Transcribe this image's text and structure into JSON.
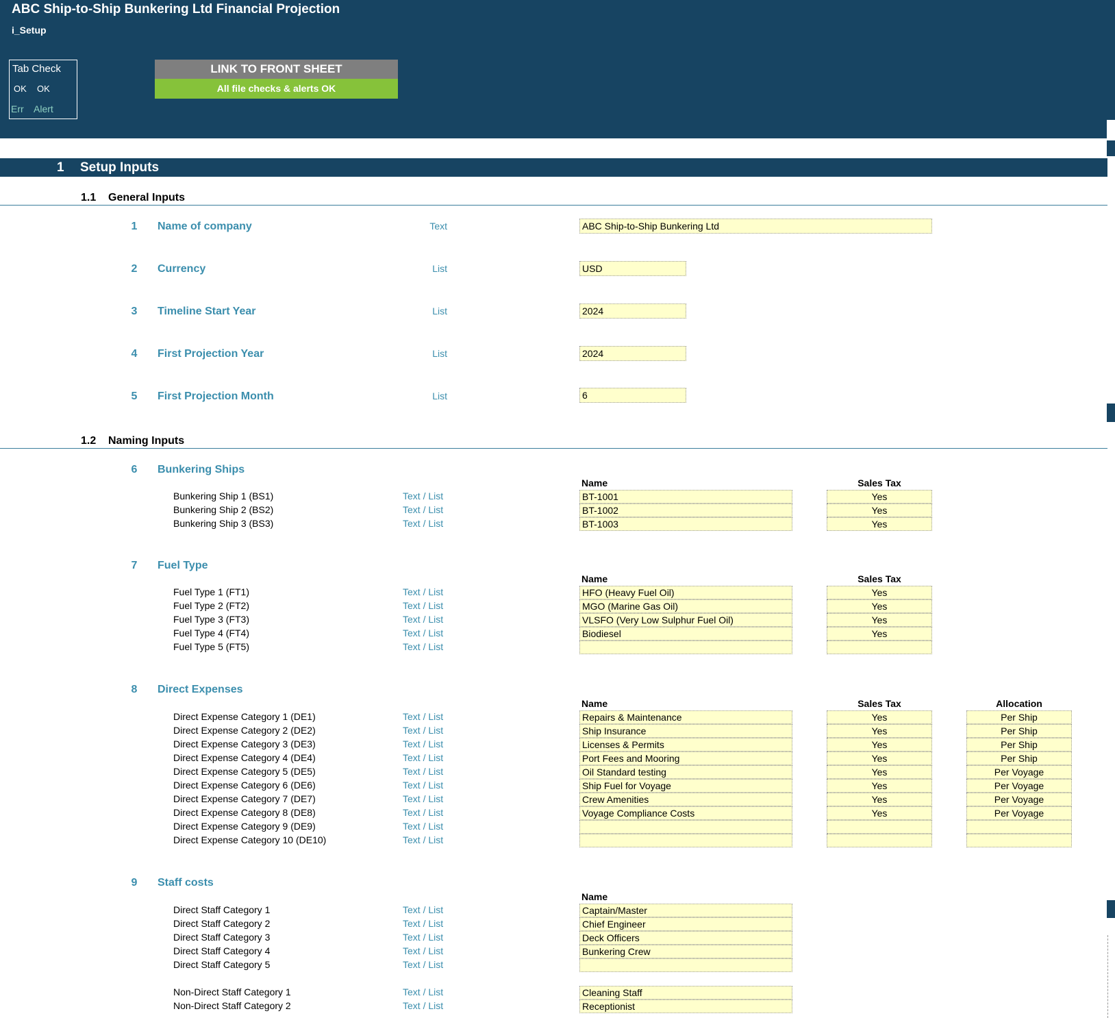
{
  "header": {
    "title": "ABC Ship-to-Ship Bunkering Ltd Financial Projection",
    "sheet": "i_Setup",
    "tab_check": {
      "title": "Tab Check",
      "ok1": "OK",
      "ok2": "OK",
      "err": "Err",
      "alert": "Alert"
    },
    "link_button": "LINK TO FRONT SHEET",
    "check_status": "All file checks & alerts OK"
  },
  "section": {
    "number": "1",
    "title": "Setup Inputs"
  },
  "general": {
    "number": "1.1",
    "title": "General Inputs",
    "items": [
      {
        "num": "1",
        "label": "Name of company",
        "type": "Text",
        "value": "ABC Ship-to-Ship Bunkering Ltd"
      },
      {
        "num": "2",
        "label": "Currency",
        "type": "List",
        "value": "USD"
      },
      {
        "num": "3",
        "label": "Timeline Start Year",
        "type": "List",
        "value": "2024"
      },
      {
        "num": "4",
        "label": "First Projection Year",
        "type": "List",
        "value": "2024"
      },
      {
        "num": "5",
        "label": "First Projection Month",
        "type": "List",
        "value": "6"
      }
    ]
  },
  "naming": {
    "number": "1.2",
    "title": "Naming Inputs",
    "col_name": "Name",
    "col_sales_tax": "Sales Tax",
    "col_allocation": "Allocation",
    "ships": {
      "num": "6",
      "title": "Bunkering Ships",
      "rows": [
        {
          "label": "Bunkering Ship 1 (BS1)",
          "type": "Text / List",
          "name": "BT-1001",
          "tax": "Yes"
        },
        {
          "label": "Bunkering Ship 2 (BS2)",
          "type": "Text / List",
          "name": "BT-1002",
          "tax": "Yes"
        },
        {
          "label": "Bunkering Ship 3 (BS3)",
          "type": "Text / List",
          "name": "BT-1003",
          "tax": "Yes"
        }
      ]
    },
    "fuel": {
      "num": "7",
      "title": "Fuel Type",
      "rows": [
        {
          "label": "Fuel Type 1 (FT1)",
          "type": "Text / List",
          "name": "HFO (Heavy Fuel Oil)",
          "tax": "Yes"
        },
        {
          "label": "Fuel Type 2 (FT2)",
          "type": "Text / List",
          "name": "MGO (Marine Gas Oil)",
          "tax": "Yes"
        },
        {
          "label": "Fuel Type 3 (FT3)",
          "type": "Text / List",
          "name": "VLSFO (Very Low Sulphur Fuel Oil)",
          "tax": "Yes"
        },
        {
          "label": "Fuel Type 4 (FT4)",
          "type": "Text / List",
          "name": "Biodiesel",
          "tax": "Yes"
        },
        {
          "label": "Fuel Type 5 (FT5)",
          "type": "Text / List",
          "name": "",
          "tax": ""
        }
      ]
    },
    "direct": {
      "num": "8",
      "title": "Direct Expenses",
      "rows": [
        {
          "label": "Direct Expense Category 1 (DE1)",
          "type": "Text / List",
          "name": "Repairs & Maintenance",
          "tax": "Yes",
          "alloc": "Per Ship"
        },
        {
          "label": "Direct Expense Category 2 (DE2)",
          "type": "Text / List",
          "name": "Ship Insurance",
          "tax": "Yes",
          "alloc": "Per Ship"
        },
        {
          "label": "Direct Expense Category 3 (DE3)",
          "type": "Text / List",
          "name": "Licenses & Permits",
          "tax": "Yes",
          "alloc": "Per Ship"
        },
        {
          "label": "Direct Expense Category 4 (DE4)",
          "type": "Text / List",
          "name": "Port Fees and Mooring",
          "tax": "Yes",
          "alloc": "Per Ship"
        },
        {
          "label": "Direct Expense Category 5 (DE5)",
          "type": "Text / List",
          "name": "Oil Standard testing",
          "tax": "Yes",
          "alloc": "Per Voyage"
        },
        {
          "label": "Direct Expense Category 6 (DE6)",
          "type": "Text / List",
          "name": "Ship Fuel for Voyage",
          "tax": "Yes",
          "alloc": "Per Voyage"
        },
        {
          "label": "Direct Expense Category 7 (DE7)",
          "type": "Text / List",
          "name": "Crew Amenities",
          "tax": "Yes",
          "alloc": "Per Voyage"
        },
        {
          "label": "Direct Expense Category 8 (DE8)",
          "type": "Text / List",
          "name": "Voyage Compliance Costs",
          "tax": "Yes",
          "alloc": "Per Voyage"
        },
        {
          "label": "Direct Expense Category 9 (DE9)",
          "type": "Text / List",
          "name": "",
          "tax": "",
          "alloc": ""
        },
        {
          "label": "Direct Expense Category 10 (DE10)",
          "type": "Text / List",
          "name": "",
          "tax": "",
          "alloc": ""
        }
      ]
    },
    "staff": {
      "num": "9",
      "title": "Staff costs",
      "direct_rows": [
        {
          "label": "Direct Staff Category 1",
          "type": "Text / List",
          "name": "Captain/Master"
        },
        {
          "label": "Direct Staff Category 2",
          "type": "Text / List",
          "name": "Chief Engineer"
        },
        {
          "label": "Direct Staff Category 3",
          "type": "Text / List",
          "name": "Deck Officers"
        },
        {
          "label": "Direct Staff Category 4",
          "type": "Text / List",
          "name": "Bunkering Crew"
        },
        {
          "label": "Direct Staff Category 5",
          "type": "Text / List",
          "name": ""
        }
      ],
      "nondirect_rows": [
        {
          "label": "Non-Direct Staff Category 1",
          "type": "Text / List",
          "name": "Cleaning Staff"
        },
        {
          "label": "Non-Direct Staff Category 2",
          "type": "Text / List",
          "name": "Receptionist"
        }
      ]
    }
  }
}
